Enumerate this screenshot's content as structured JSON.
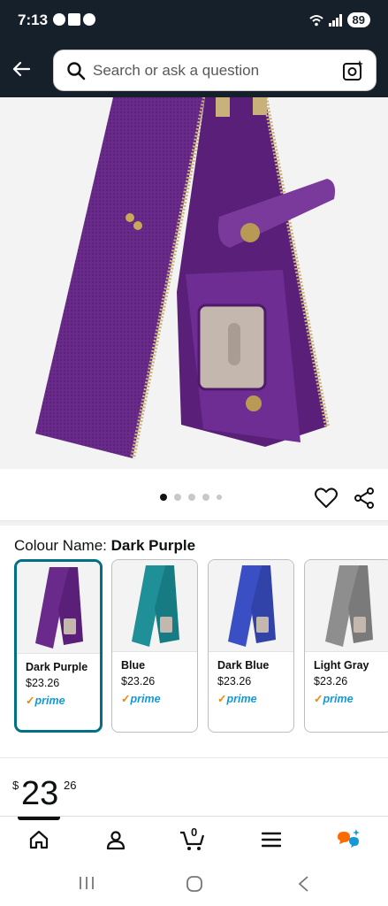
{
  "status_bar": {
    "time": "7:13",
    "battery": "89"
  },
  "search": {
    "placeholder": "Search or ask a question"
  },
  "gallery": {
    "dot_count": 5,
    "active_dot": 0
  },
  "colour": {
    "label": "Colour Name: ",
    "value": "Dark Purple"
  },
  "swatches": [
    {
      "name": "Dark Purple",
      "price": "$23.26",
      "prime": "prime",
      "color": "#6a2a8c",
      "selected": true
    },
    {
      "name": "Blue",
      "price": "$23.26",
      "prime": "prime",
      "color": "#1f8f98",
      "selected": false
    },
    {
      "name": "Dark Blue",
      "price": "$23.26",
      "prime": "prime",
      "color": "#3b4fc4",
      "selected": false
    },
    {
      "name": "Light Gray",
      "price": "$23.26",
      "prime": "prime",
      "color": "#8e8e8e",
      "selected": false
    }
  ],
  "price": {
    "symbol": "$",
    "whole": "23",
    "fraction": "26"
  },
  "nav": {
    "cart_count": "0"
  },
  "colors": {
    "header_bg": "#15202b",
    "accent": "#007185",
    "prime_blue": "#1399d6",
    "prime_check": "#f08804",
    "assistant_orange": "#ff6a00",
    "assistant_blue": "#1399d6"
  }
}
